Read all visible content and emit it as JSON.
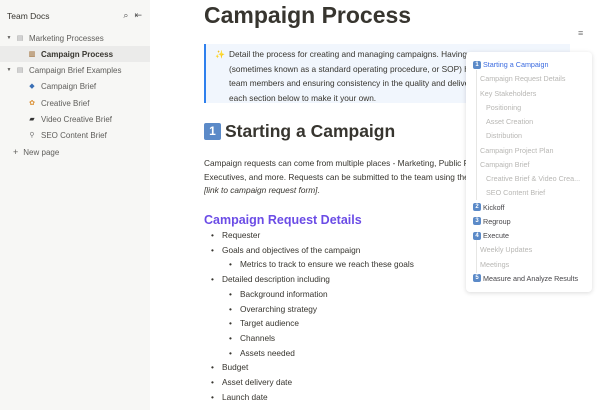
{
  "sidebar": {
    "title": "Team Docs",
    "items": [
      {
        "label": "Marketing Processes",
        "icon": "page-icon"
      },
      {
        "label": "Campaign Process",
        "icon": "notepad-icon"
      },
      {
        "label": "Campaign Brief Examples",
        "icon": "page-icon"
      },
      {
        "label": "Campaign Brief",
        "icon": "blue-diamond-icon"
      },
      {
        "label": "Creative Brief",
        "icon": "palette-icon"
      },
      {
        "label": "Video Creative Brief",
        "icon": "clapper-icon"
      },
      {
        "label": "SEO Content Brief",
        "icon": "magnifier-icon"
      }
    ],
    "new_page": "New page"
  },
  "doc": {
    "title": "Campaign Process",
    "callout": [
      "Detail the process for creating and managing campaigns. Having",
      "(sometimes known as a standard operating procedure, or SOP) h",
      "team members and ensuring consistency in the quality and delive",
      "each section below to make it your own."
    ],
    "section1": {
      "number": "1",
      "title": "Starting a Campaign"
    },
    "para": [
      "Campaign requests can come from multiple places - Marketing, Public R",
      "Executives, and more. Requests can be submitted to the team using the"
    ],
    "para_link": "[link to campaign request form]",
    "para_end": ".",
    "subheading": "Campaign Request Details",
    "bullets": [
      {
        "text": "Requester",
        "level": 0
      },
      {
        "text": "Goals and objectives of the campaign",
        "level": 0
      },
      {
        "text": "Metrics to track to ensure we reach these goals",
        "level": 1
      },
      {
        "text": "Detailed description including",
        "level": 0
      },
      {
        "text": "Background information",
        "level": 1
      },
      {
        "text": "Overarching strategy",
        "level": 1
      },
      {
        "text": "Target audience",
        "level": 1
      },
      {
        "text": "Channels",
        "level": 1
      },
      {
        "text": "Assets needed",
        "level": 1
      },
      {
        "text": "Budget",
        "level": 0
      },
      {
        "text": "Asset delivery date",
        "level": 0
      },
      {
        "text": "Launch date",
        "level": 0
      }
    ]
  },
  "toc": [
    {
      "label": "Starting a Campaign",
      "num": "1",
      "level": 0
    },
    {
      "label": "Campaign Request Details",
      "level": 1
    },
    {
      "label": "Key Stakeholders",
      "level": 1
    },
    {
      "label": "Positioning",
      "level": 2
    },
    {
      "label": "Asset Creation",
      "level": 2
    },
    {
      "label": "Distribution",
      "level": 2
    },
    {
      "label": "Campaign Project Plan",
      "level": 1
    },
    {
      "label": "Campaign Brief",
      "level": 1
    },
    {
      "label": "Creative Brief & Video Crea...",
      "level": 2
    },
    {
      "label": "SEO Content Brief",
      "level": 2
    },
    {
      "label": "Kickoff",
      "num": "2",
      "level": 0
    },
    {
      "label": "Regroup",
      "num": "3",
      "level": 0
    },
    {
      "label": "Execute",
      "num": "4",
      "level": 0
    },
    {
      "label": "Weekly Updates",
      "level": 1
    },
    {
      "label": "Meetings",
      "level": 1
    },
    {
      "label": "Measure and Analyze Results",
      "num": "5",
      "level": 0
    }
  ]
}
